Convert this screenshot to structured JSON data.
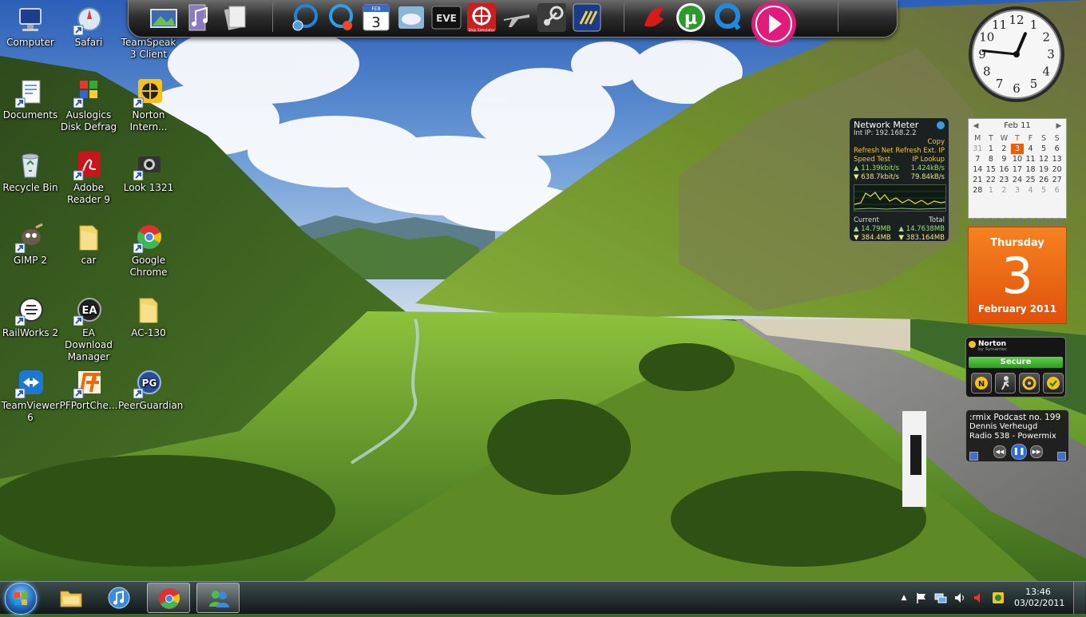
{
  "desktop": {
    "icons": [
      {
        "label": "Computer"
      },
      {
        "label": "Safari"
      },
      {
        "label": "TeamSpeak 3 Client"
      },
      {
        "label": "Documents"
      },
      {
        "label": "Auslogics Disk Defrag"
      },
      {
        "label": "Norton Intern..."
      },
      {
        "label": "Recycle Bin"
      },
      {
        "label": "Adobe Reader 9"
      },
      {
        "label": "Look 1321"
      },
      {
        "label": "GIMP 2"
      },
      {
        "label": "car"
      },
      {
        "label": "Google Chrome"
      },
      {
        "label": "RailWorks 2"
      },
      {
        "label": "EA Download Manager"
      },
      {
        "label": "AC-130"
      },
      {
        "label": "TeamViewer 6"
      },
      {
        "label": "PFPortChe..."
      },
      {
        "label": "PeerGuardian"
      }
    ]
  },
  "dock": {
    "items": [
      "photo-gallery-icon",
      "music-app-icon",
      "documents-app-icon",
      "system-tools-icon",
      "skype-icon",
      "calendar-app-icon",
      "weather-app-icon",
      "eve-online-icon",
      "ship-simulator-icon",
      "flight-simulator-icon",
      "steam-icon",
      "game-launcher-icon",
      "ea-icon",
      "utorrent-icon",
      "quicktime-icon",
      "itunes-icon"
    ],
    "calendar_day": "3",
    "calendar_month_abbr": "FEB",
    "eve_label": "EVE",
    "ship_label": "Ship Simulator"
  },
  "gadgets": {
    "clock": {
      "hour": 12,
      "minute": 46
    },
    "calendar": {
      "header": "Feb 11",
      "weekdays": [
        "M",
        "T",
        "W",
        "T",
        "F",
        "S",
        "S"
      ],
      "weeks": [
        [
          "31",
          "1",
          "2",
          "3",
          "4",
          "5",
          "6"
        ],
        [
          "7",
          "8",
          "9",
          "10",
          "11",
          "12",
          "13"
        ],
        [
          "14",
          "15",
          "16",
          "17",
          "18",
          "19",
          "20"
        ],
        [
          "21",
          "22",
          "23",
          "24",
          "25",
          "26",
          "27"
        ],
        [
          "28",
          "1",
          "2",
          "3",
          "4",
          "5",
          "6"
        ]
      ],
      "weekday_full": "Thursday",
      "day": "3",
      "month_year": "February 2011"
    },
    "network_meter": {
      "title": "Network Meter",
      "int_ip": "Int IP: 192.168.2.2",
      "copy": "Copy",
      "refresh_net": "Refresh Net",
      "refresh_ext_ip": "Refresh Ext. IP",
      "speed_test": "Speed Test",
      "ip_lookup": "IP Lookup",
      "up_speed_1": "11.39kbit/s",
      "up_speed_2": "1.424kB/s",
      "down_speed_1": "638.7kbit/s",
      "down_speed_2": "79.84kB/s",
      "current": "Current",
      "total": "Total",
      "current_up": "14.79MB",
      "current_down": "384.4MB",
      "total_up": "14.7638MB",
      "total_down": "383.164MB"
    },
    "norton": {
      "logo": "Norton",
      "sub": "by Symantec",
      "status": "Secure"
    },
    "radio": {
      "title": ":rmix Podcast no. 199",
      "artist": "Dennis Verheugd",
      "station": "Radio 538 - Powermix"
    }
  },
  "taskbar": {
    "time": "13:46",
    "date": "03/02/2011",
    "tray_arrow": "▲"
  },
  "colors": {
    "calendar_accent": "#e8600e",
    "norton_green": "#3fb02c",
    "taskbar": "#1a2028"
  }
}
